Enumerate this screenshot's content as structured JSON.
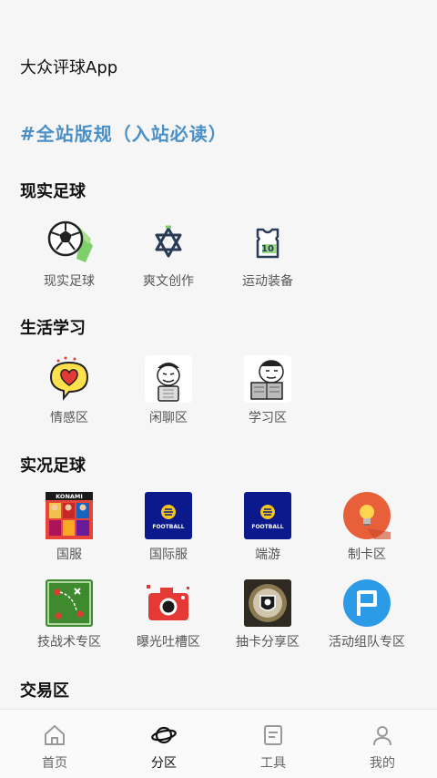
{
  "header": {
    "app_name": "大众评球App"
  },
  "rules_link": "#全站版规（入站必读）",
  "sections": [
    {
      "title": "现实足球",
      "items": [
        {
          "label": "现实足球",
          "icon": "soccer-ball-icon"
        },
        {
          "label": "爽文创作",
          "icon": "star-of-david-icon"
        },
        {
          "label": "运动装备",
          "icon": "jersey-icon"
        }
      ]
    },
    {
      "title": "生活学习",
      "items": [
        {
          "label": "情感区",
          "icon": "heart-bubble-icon"
        },
        {
          "label": "闲聊区",
          "icon": "meme-face-icon"
        },
        {
          "label": "学习区",
          "icon": "meme-reading-icon"
        }
      ]
    },
    {
      "title": "实况足球",
      "items": [
        {
          "label": "国服",
          "icon": "konami-cover-icon",
          "badge_text": "KONAMI"
        },
        {
          "label": "国际服",
          "icon": "efootball-logo-icon",
          "badge_text": "FOOTBALL"
        },
        {
          "label": "端游",
          "icon": "efootball-logo-icon",
          "badge_text": "FOOTBALL"
        },
        {
          "label": "制卡区",
          "icon": "lightbulb-icon"
        },
        {
          "label": "技战术专区",
          "icon": "tactics-board-icon"
        },
        {
          "label": "曝光吐槽区",
          "icon": "camera-icon"
        },
        {
          "label": "抽卡分享区",
          "icon": "card-pack-icon"
        },
        {
          "label": "活动组队专区",
          "icon": "flag-icon"
        }
      ]
    },
    {
      "title": "交易区",
      "items": []
    }
  ],
  "bottom_nav": [
    {
      "label": "首页",
      "icon": "home-icon",
      "active": false
    },
    {
      "label": "分区",
      "icon": "planet-icon",
      "active": true
    },
    {
      "label": "工具",
      "icon": "tools-icon",
      "active": false
    },
    {
      "label": "我的",
      "icon": "profile-icon",
      "active": false
    }
  ],
  "colors": {
    "link": "#4a90c8",
    "active_nav": "#111111",
    "inactive_nav": "#999999"
  }
}
